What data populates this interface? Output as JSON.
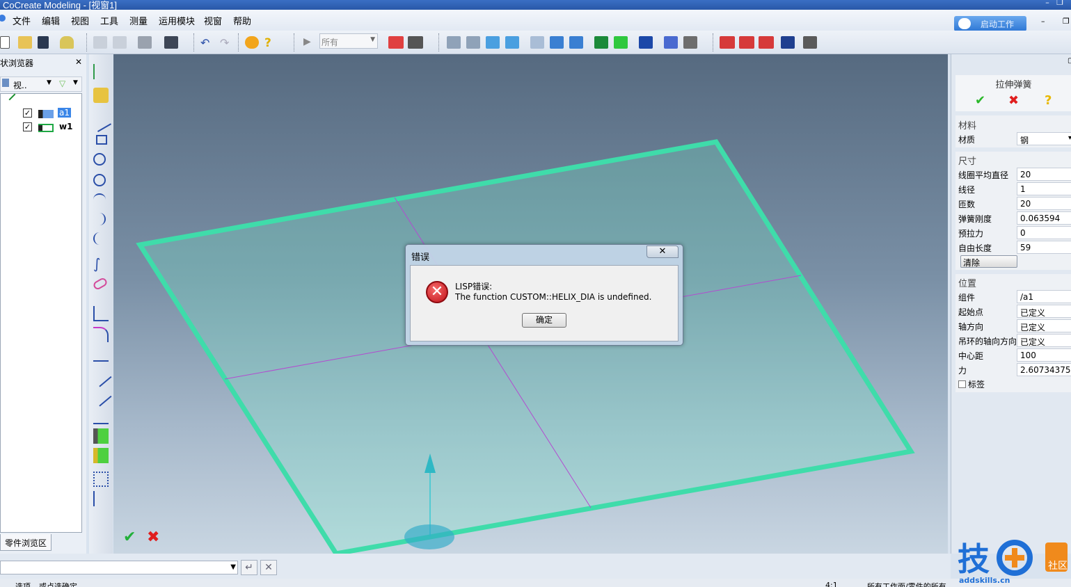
{
  "window": {
    "title": "CoCreate Modeling - [视窗1]"
  },
  "menu": {
    "items": [
      "文件",
      "编辑",
      "视图",
      "工具",
      "测量",
      "运用模块",
      "视窗",
      "帮助"
    ]
  },
  "top_button": {
    "label": "启动工作"
  },
  "toolbar": {
    "filter_value": "所有"
  },
  "left_panel": {
    "title": "状浏览器",
    "view_label": "视..",
    "tree": [
      {
        "label": "a1",
        "checked": true,
        "selected": true
      },
      {
        "label": "w1",
        "checked": true,
        "selected": false
      }
    ],
    "tab_label": "零件浏览区"
  },
  "dialog": {
    "title": "错误",
    "close_glyph": "✕",
    "message_line1": "LISP错误:",
    "message_line2": "The function CUSTOM::HELIX_DIA is undefined.",
    "ok_label": "确定"
  },
  "right_panel": {
    "title": "拉伸弹簧",
    "sections": {
      "material": {
        "title": "材料",
        "rows": [
          {
            "label": "材质",
            "value": "钢"
          }
        ]
      },
      "dimensions": {
        "title": "尺寸",
        "rows": [
          {
            "label": "线圈平均直径",
            "value": "20"
          },
          {
            "label": "线径",
            "value": "1"
          },
          {
            "label": "匝数",
            "value": "20"
          },
          {
            "label": "弹簧刚度",
            "value": "0.063594"
          },
          {
            "label": "预拉力",
            "value": "0"
          },
          {
            "label": "自由长度",
            "value": "59"
          }
        ],
        "clear_label": "清除"
      },
      "position": {
        "title": "位置",
        "rows": [
          {
            "label": "组件",
            "value": "/a1"
          },
          {
            "label": "起始点",
            "value": "已定义"
          },
          {
            "label": "轴方向",
            "value": "已定义"
          },
          {
            "label": "吊环的轴向方向",
            "value": "已定义"
          },
          {
            "label": "中心距",
            "value": "100"
          },
          {
            "label": "力",
            "value": "2.60734375"
          }
        ],
        "tag_label": "标签"
      }
    }
  },
  "status": {
    "left1": "选项",
    "left2": "或点选确定",
    "mid": "4:1",
    "right": "所有工作面/零件的所有"
  },
  "watermark": {
    "text": "技",
    "sub": "addskills.cn",
    "badge": "社区"
  },
  "colors": {
    "plane": "#3fdcaa",
    "accent": "#2d77d5",
    "error": "#c0121a"
  }
}
